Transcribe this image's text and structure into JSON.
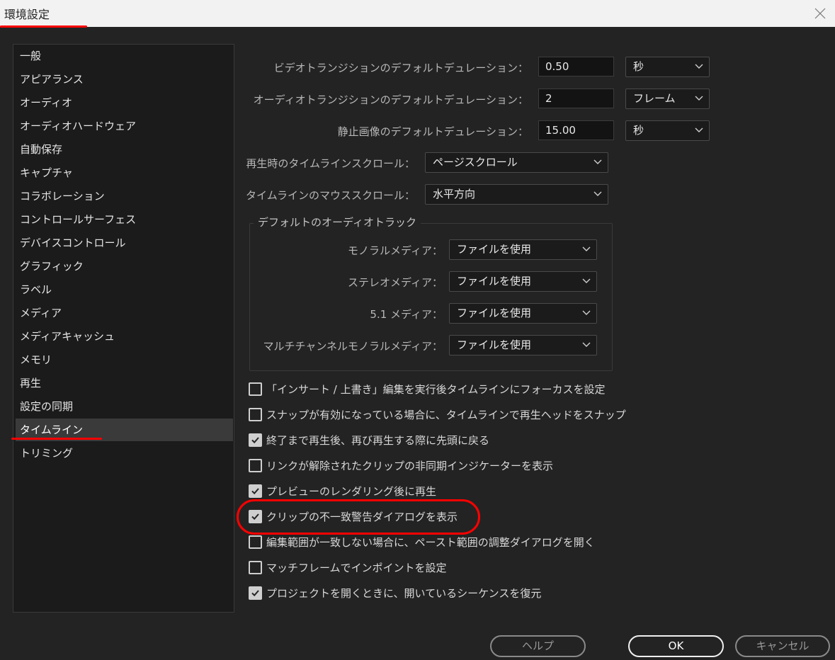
{
  "window": {
    "title": "環境設定"
  },
  "sidebar": {
    "items": [
      {
        "label": "一般",
        "active": false
      },
      {
        "label": "アピアランス",
        "active": false
      },
      {
        "label": "オーディオ",
        "active": false
      },
      {
        "label": "オーディオハードウェア",
        "active": false
      },
      {
        "label": "自動保存",
        "active": false
      },
      {
        "label": "キャプチャ",
        "active": false
      },
      {
        "label": "コラボレーション",
        "active": false
      },
      {
        "label": "コントロールサーフェス",
        "active": false
      },
      {
        "label": "デバイスコントロール",
        "active": false
      },
      {
        "label": "グラフィック",
        "active": false
      },
      {
        "label": "ラベル",
        "active": false
      },
      {
        "label": "メディア",
        "active": false
      },
      {
        "label": "メディアキャッシュ",
        "active": false
      },
      {
        "label": "メモリ",
        "active": false
      },
      {
        "label": "再生",
        "active": false
      },
      {
        "label": "設定の同期",
        "active": false
      },
      {
        "label": "タイムライン",
        "active": true
      },
      {
        "label": "トリミング",
        "active": false
      }
    ]
  },
  "settings": {
    "video_transition": {
      "label": "ビデオトランジションのデフォルトデュレーション：",
      "value": "0.50",
      "unit": "秒"
    },
    "audio_transition": {
      "label": "オーディオトランジションのデフォルトデュレーション：",
      "value": "2",
      "unit": "フレーム"
    },
    "still_image": {
      "label": "静止画像のデフォルトデュレーション：",
      "value": "15.00",
      "unit": "秒"
    },
    "playback_scroll": {
      "label": "再生時のタイムラインスクロール：",
      "value": "ページスクロール"
    },
    "mouse_scroll": {
      "label": "タイムラインのマウススクロール：",
      "value": "水平方向"
    }
  },
  "audio_tracks": {
    "title": "デフォルトのオーディオトラック",
    "rows": [
      {
        "label": "モノラルメディア：",
        "value": "ファイルを使用"
      },
      {
        "label": "ステレオメディア：",
        "value": "ファイルを使用"
      },
      {
        "label": "5.1 メディア：",
        "value": "ファイルを使用"
      },
      {
        "label": "マルチチャンネルモノラルメディア：",
        "value": "ファイルを使用"
      }
    ]
  },
  "checkboxes": [
    {
      "label": "「インサート / 上書き」編集を実行後タイムラインにフォーカスを設定",
      "checked": false
    },
    {
      "label": "スナップが有効になっている場合に、タイムラインで再生ヘッドをスナップ",
      "checked": false
    },
    {
      "label": "終了まで再生後、再び再生する際に先頭に戻る",
      "checked": true
    },
    {
      "label": "リンクが解除されたクリップの非同期インジケーターを表示",
      "checked": false
    },
    {
      "label": "プレビューのレンダリング後に再生",
      "checked": true
    },
    {
      "label": "クリップの不一致警告ダイアログを表示",
      "checked": true
    },
    {
      "label": "編集範囲が一致しない場合に、ペースト範囲の調整ダイアログを開く",
      "checked": false
    },
    {
      "label": "マッチフレームでインポイントを設定",
      "checked": false
    },
    {
      "label": "プロジェクトを開くときに、開いているシーケンスを復元",
      "checked": true
    }
  ],
  "buttons": {
    "help": "ヘルプ",
    "ok": "OK",
    "cancel": "キャンセル"
  },
  "colors": {
    "annotation": "#ff0000",
    "background": "#232323",
    "sidebar_active": "#3a3a3a"
  }
}
